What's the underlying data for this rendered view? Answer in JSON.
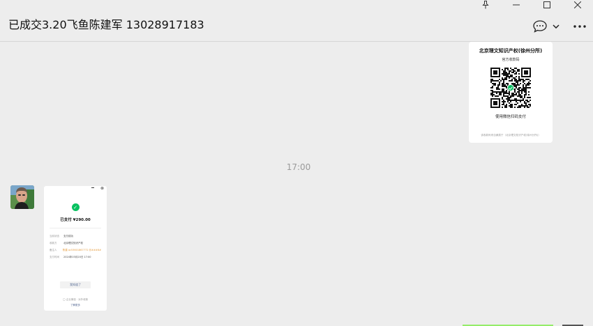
{
  "window": {
    "title": "已成交3.20飞鱼陈建军 13028917183"
  },
  "chat": {
    "timestamp": "17:00",
    "qr_card": {
      "title": "北京理文知识产权(徐州分所)",
      "subtitle": "官方收款码",
      "pay_hint": "使用微信扫码支付",
      "footer": "该收款码来自隶属于（北京理文知识产权(徐州分所)）"
    },
    "receipt": {
      "paid_text": "已支付 ¥290.00",
      "rows": [
        {
          "key": "当前状态",
          "value": "支付成功",
          "accent": false
        },
        {
          "key": "收款方",
          "value": "北京理文知识产权",
          "accent": false
        },
        {
          "key": "备注人",
          "value": "陈建 ac53601867772 @###8#",
          "accent": true
        },
        {
          "key": "支付时间",
          "value": "2024年03月20日 17:00",
          "accent": false
        }
      ],
      "done_label": "我知道了",
      "footer_line1": "◯ 企业微信 · 对外收款",
      "footer_line2": "了解更多"
    }
  },
  "colors": {
    "background": "#ededed",
    "success": "#07c160",
    "link": "#576b95"
  }
}
